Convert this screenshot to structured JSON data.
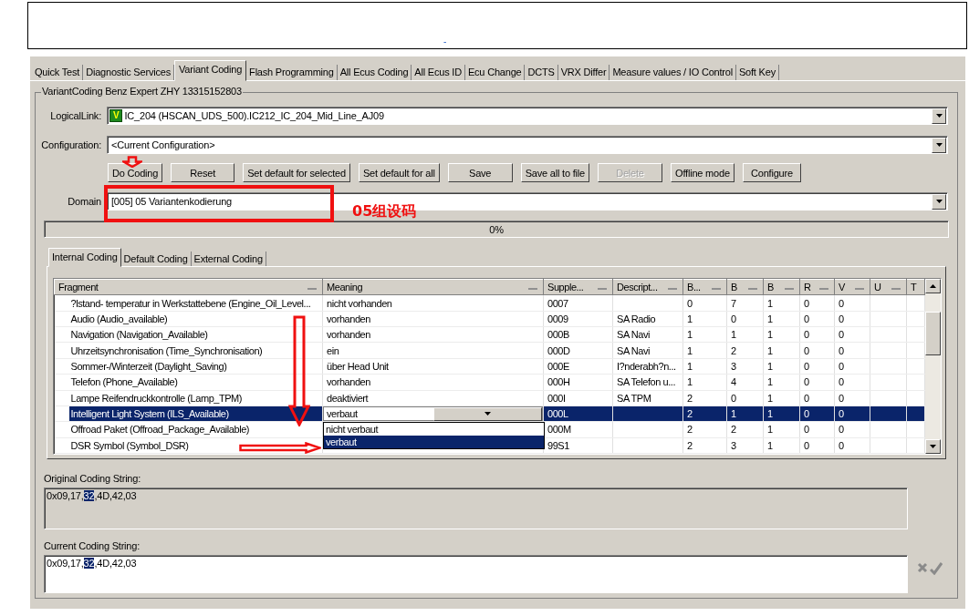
{
  "banner": {
    "mark": "-"
  },
  "tabs": [
    {
      "label": "Quick Test",
      "selected": false
    },
    {
      "label": "Diagnostic Services",
      "selected": false
    },
    {
      "label": "Variant Coding",
      "selected": true
    },
    {
      "label": "Flash Programming",
      "selected": false
    },
    {
      "label": "All Ecus Coding",
      "selected": false
    },
    {
      "label": "All Ecus ID",
      "selected": false
    },
    {
      "label": "Ecu Change",
      "selected": false
    },
    {
      "label": "DCTS",
      "selected": false
    },
    {
      "label": "VRX Differ",
      "selected": false
    },
    {
      "label": "Measure values / IO Control",
      "selected": false
    },
    {
      "label": "Soft Key",
      "selected": false
    }
  ],
  "group_title": "VariantCoding Benz Expert ZHY 13315152803",
  "logical_link": {
    "label": "LogicalLink:",
    "badge": "V",
    "value": "IC_204 (HSCAN_UDS_500).IC212_IC_204_Mid_Line_AJ09"
  },
  "configuration": {
    "label": "Configuration:",
    "value": "<Current Configuration>"
  },
  "buttons": [
    {
      "label": "Do Coding",
      "disabled": false
    },
    {
      "label": "Reset",
      "disabled": false
    },
    {
      "label": "Set default for selected",
      "disabled": false
    },
    {
      "label": "Set default for all",
      "disabled": false
    },
    {
      "label": "Save",
      "disabled": false
    },
    {
      "label": "Save all to file",
      "disabled": false
    },
    {
      "label": "Delete",
      "disabled": true
    },
    {
      "label": "Offline mode",
      "disabled": false
    },
    {
      "label": "Configure",
      "disabled": false
    }
  ],
  "domain": {
    "label": "Domain",
    "value": "[005] 05 Variantenkodierung"
  },
  "progress": {
    "level": 0,
    "reading": "0%"
  },
  "sub_tabs": [
    {
      "label": "Internal Coding",
      "selected": true
    },
    {
      "label": "Default Coding",
      "selected": false
    },
    {
      "label": "External Coding",
      "selected": false
    }
  ],
  "grid": {
    "columns": [
      "Fragment",
      "Meaning",
      "Supple...",
      "Descript...",
      "B...",
      "B",
      "B",
      "R",
      "V",
      "U",
      "T"
    ],
    "rows": [
      {
        "cells": [
          "?lstand- temperatur in Werkstattebene (Engine_Oil_Level...",
          "nicht vorhanden",
          "0007",
          "",
          "0",
          "7",
          "1",
          "0",
          "0",
          "",
          ""
        ],
        "selected": false
      },
      {
        "cells": [
          "Audio (Audio_available)",
          "vorhanden",
          "0009",
          "SA Radio",
          "1",
          "0",
          "1",
          "0",
          "0",
          "",
          ""
        ],
        "selected": false
      },
      {
        "cells": [
          "Navigation (Navigation_Available)",
          "vorhanden",
          "000B",
          "SA Navi",
          "1",
          "1",
          "1",
          "0",
          "0",
          "",
          ""
        ],
        "selected": false
      },
      {
        "cells": [
          "Uhrzeitsynchronisation (Time_Synchronisation)",
          "ein",
          "000D",
          "SA Navi",
          "1",
          "2",
          "1",
          "0",
          "0",
          "",
          ""
        ],
        "selected": false
      },
      {
        "cells": [
          "Sommer-/Winterzeit (Daylight_Saving)",
          "über Head Unit",
          "000E",
          "I?nderabh?n...",
          "1",
          "3",
          "1",
          "0",
          "0",
          "",
          ""
        ],
        "selected": false
      },
      {
        "cells": [
          "Telefon (Phone_Available)",
          "vorhanden",
          "000H",
          "SA Telefon u...",
          "1",
          "4",
          "1",
          "0",
          "0",
          "",
          ""
        ],
        "selected": false
      },
      {
        "cells": [
          "Lampe Reifendruckkontrolle (Lamp_TPM)",
          "deaktiviert",
          "000I",
          "SA TPM",
          "2",
          "0",
          "1",
          "0",
          "0",
          "",
          ""
        ],
        "selected": false
      },
      {
        "cells": [
          "Intelligent Light System (ILS_Available)",
          "",
          "000L",
          "",
          "2",
          "1",
          "1",
          "0",
          "0",
          "",
          ""
        ],
        "editor": {
          "value": "verbaut",
          "options": [
            {
              "label": "nicht verbaut",
              "selected": false
            },
            {
              "label": "verbaut",
              "selected": true
            }
          ]
        },
        "selected": true
      },
      {
        "cells": [
          "Offroad Paket (Offroad_Package_Available)",
          "",
          "000M",
          "",
          "2",
          "2",
          "1",
          "0",
          "0",
          "",
          ""
        ],
        "selected": false
      },
      {
        "cells": [
          "DSR Symbol (Symbol_DSR)",
          "",
          "99S1",
          "",
          "2",
          "3",
          "1",
          "0",
          "0",
          "",
          ""
        ],
        "selected": false
      }
    ]
  },
  "original_coding": {
    "label": "Original Coding String:",
    "before": "0x09,17,",
    "selected": "32",
    "after": ",4D,42,03",
    "editable": false
  },
  "current_coding": {
    "label": "Current Coding String:",
    "before": "0x09,17,",
    "selected": "32",
    "after": ",4D,42,03",
    "editable": true
  },
  "annotations": [
    {
      "kind": "arrow-down"
    },
    {
      "kind": "box"
    },
    {
      "kind": "label",
      "text": "05组设码"
    },
    {
      "kind": "arrow-long-down"
    },
    {
      "kind": "arrow-right"
    }
  ]
}
